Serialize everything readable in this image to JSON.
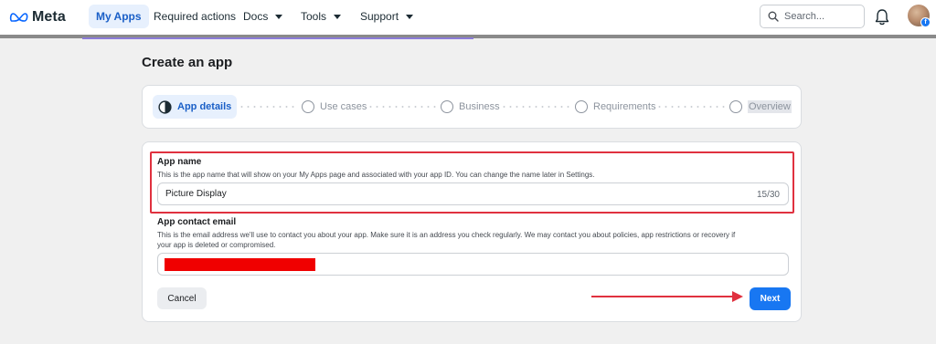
{
  "brand": {
    "name": "Meta"
  },
  "nav": {
    "items": [
      {
        "label": "My Apps",
        "active": true,
        "has_caret": false
      },
      {
        "label": "Required actions",
        "active": false,
        "has_caret": false
      },
      {
        "label": "Docs",
        "active": false,
        "has_caret": true
      },
      {
        "label": "Tools",
        "active": false,
        "has_caret": true
      },
      {
        "label": "Support",
        "active": false,
        "has_caret": true
      }
    ],
    "search_placeholder": "Search...",
    "notifications_icon": "bell-icon",
    "avatar_badge_icon": "facebook-icon"
  },
  "page": {
    "title": "Create an app"
  },
  "stepper": {
    "steps": [
      {
        "label": "App details",
        "state": "current"
      },
      {
        "label": "Use cases",
        "state": "pending"
      },
      {
        "label": "Business",
        "state": "pending"
      },
      {
        "label": "Requirements",
        "state": "pending"
      },
      {
        "label": "Overview",
        "state": "pending"
      }
    ]
  },
  "form": {
    "app_name": {
      "label": "App name",
      "description": "This is the app name that will show on your My Apps page and associated with your app ID. You can change the name later in Settings.",
      "value": "Picture Display",
      "counter": "15/30"
    },
    "contact_email": {
      "label": "App contact email",
      "description_line1": "This is the email address we'll use to contact you about your app. Make sure it is an address you check regularly. We may contact you about policies, app restrictions or recovery if",
      "description_line2": "your app is deleted or compromised.",
      "value": ""
    },
    "cancel_label": "Cancel",
    "next_label": "Next"
  },
  "colors": {
    "accent": "#1877f2",
    "active_nav_bg": "#e7f0fd",
    "highlight_border": "#e0313f",
    "redaction": "#f00000",
    "annotation_arrow": "#e0313f"
  }
}
